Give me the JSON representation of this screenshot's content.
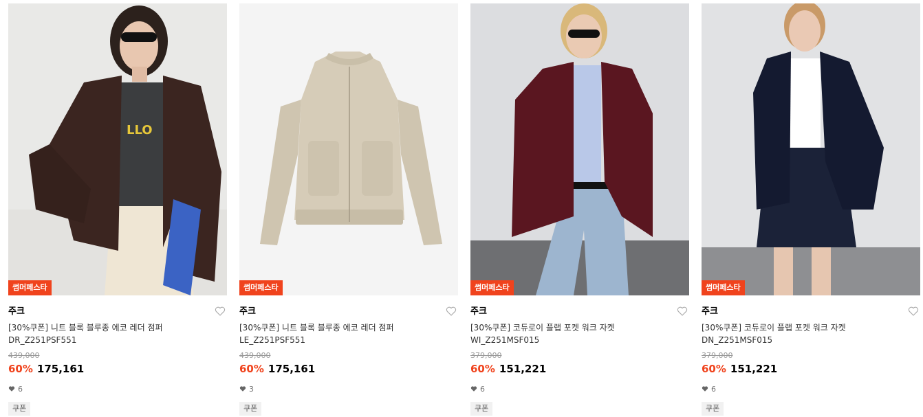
{
  "colors": {
    "accent": "#f0431d",
    "price": "#000000",
    "muted": "#999999",
    "coupon_bg": "#f1f1f1"
  },
  "products": [
    {
      "badge": "썸머페스타",
      "brand": "주크",
      "name": "[30%쿠폰] 니트 블록 블루종 에코 레더 점퍼",
      "code": "DR_Z251PSF551",
      "original_price": "439,000",
      "discount": "60%",
      "price": "175,161",
      "likes": "6",
      "coupon": "쿠폰",
      "image": "model-brown-leather-jacket"
    },
    {
      "badge": "썸머페스타",
      "brand": "주크",
      "name": "[30%쿠폰] 니트 블록 블루종 에코 레더 점퍼",
      "code": "LE_Z251PSF551",
      "original_price": "439,000",
      "discount": "60%",
      "price": "175,161",
      "likes": "3",
      "coupon": "쿠폰",
      "image": "beige-leather-jacket-flatlay"
    },
    {
      "badge": "썸머페스타",
      "brand": "주크",
      "name": "[30%쿠폰] 코듀로이 플랩 포켓 워크 자켓",
      "code": "WI_Z251MSF015",
      "original_price": "379,000",
      "discount": "60%",
      "price": "151,221",
      "likes": "6",
      "coupon": "쿠폰",
      "image": "model-burgundy-corduroy-jacket"
    },
    {
      "badge": "썸머페스타",
      "brand": "주크",
      "name": "[30%쿠폰] 코듀로이 플랩 포켓 워크 자켓",
      "code": "DN_Z251MSF015",
      "original_price": "379,000",
      "discount": "60%",
      "price": "151,221",
      "likes": "6",
      "coupon": "쿠폰",
      "image": "model-navy-corduroy-jacket"
    }
  ]
}
